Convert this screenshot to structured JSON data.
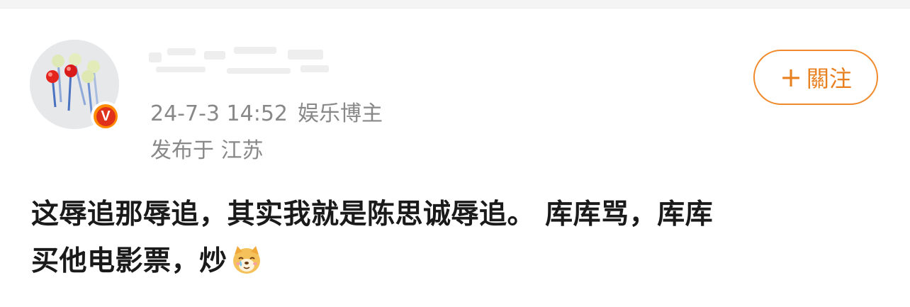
{
  "post": {
    "author_name": "",
    "timestamp": "24-7-3 14:52",
    "author_type": "娱乐博主",
    "location": "发布于 江苏",
    "follow_label": "關注",
    "follow_plus": "+",
    "badge_letter": "V",
    "content_line1": "这辱追那辱追，其实我就是陈思诚辱追。  库库骂，库库",
    "content_line2": "买他电影票，炒",
    "emoji": "crying-dog-emoji"
  },
  "colors": {
    "accent": "#f08a2c",
    "badge_red": "#e0321b",
    "meta_gray": "#888888",
    "text": "#1a1a1a"
  }
}
